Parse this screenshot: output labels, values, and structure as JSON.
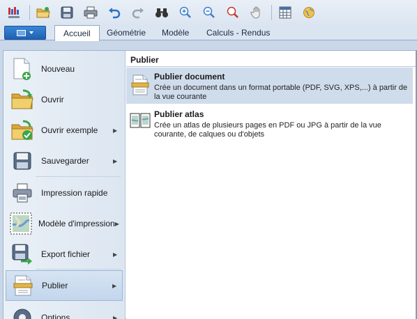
{
  "toolbar": {
    "buttons": [
      "app-logo-icon",
      "open-folder-icon",
      "save-icon",
      "print-icon",
      "undo-icon",
      "redo-icon",
      "binoculars-icon",
      "zoom-in-icon",
      "zoom-out-icon",
      "zoom-area-icon",
      "pan-hand-icon",
      "table-icon",
      "globe-icon"
    ]
  },
  "tabs": {
    "accueil": "Accueil",
    "geometrie": "Géométrie",
    "modele": "Modèle",
    "calculs": "Calculs - Rendus"
  },
  "menu": {
    "nouveau": "Nouveau",
    "ouvrir": "Ouvrir",
    "ouvrir_exemple": "Ouvrir exemple",
    "sauvegarder": "Sauvegarder",
    "impression_rapide": "Impression rapide",
    "modele_impression": "Modèle d'impression",
    "export_fichier": "Export fichier",
    "publier": "Publier",
    "options": "Options"
  },
  "panel": {
    "title": "Publier",
    "entries": [
      {
        "title": "Publier document",
        "desc_line1": "Crée un document dans un format portable (PDF, SVG, XPS,...) à partir de",
        "desc_line2": "la vue courante"
      },
      {
        "title": "Publier atlas",
        "desc_line1": "Crée un atlas de plusieurs pages en PDF ou JPG à partir de la vue",
        "desc_line2": "courante, de calques ou d'objets"
      }
    ]
  },
  "colors": {
    "accent": "#1f61b3",
    "selection": "#cfdceb",
    "ribbon": "#dbe5f1"
  }
}
